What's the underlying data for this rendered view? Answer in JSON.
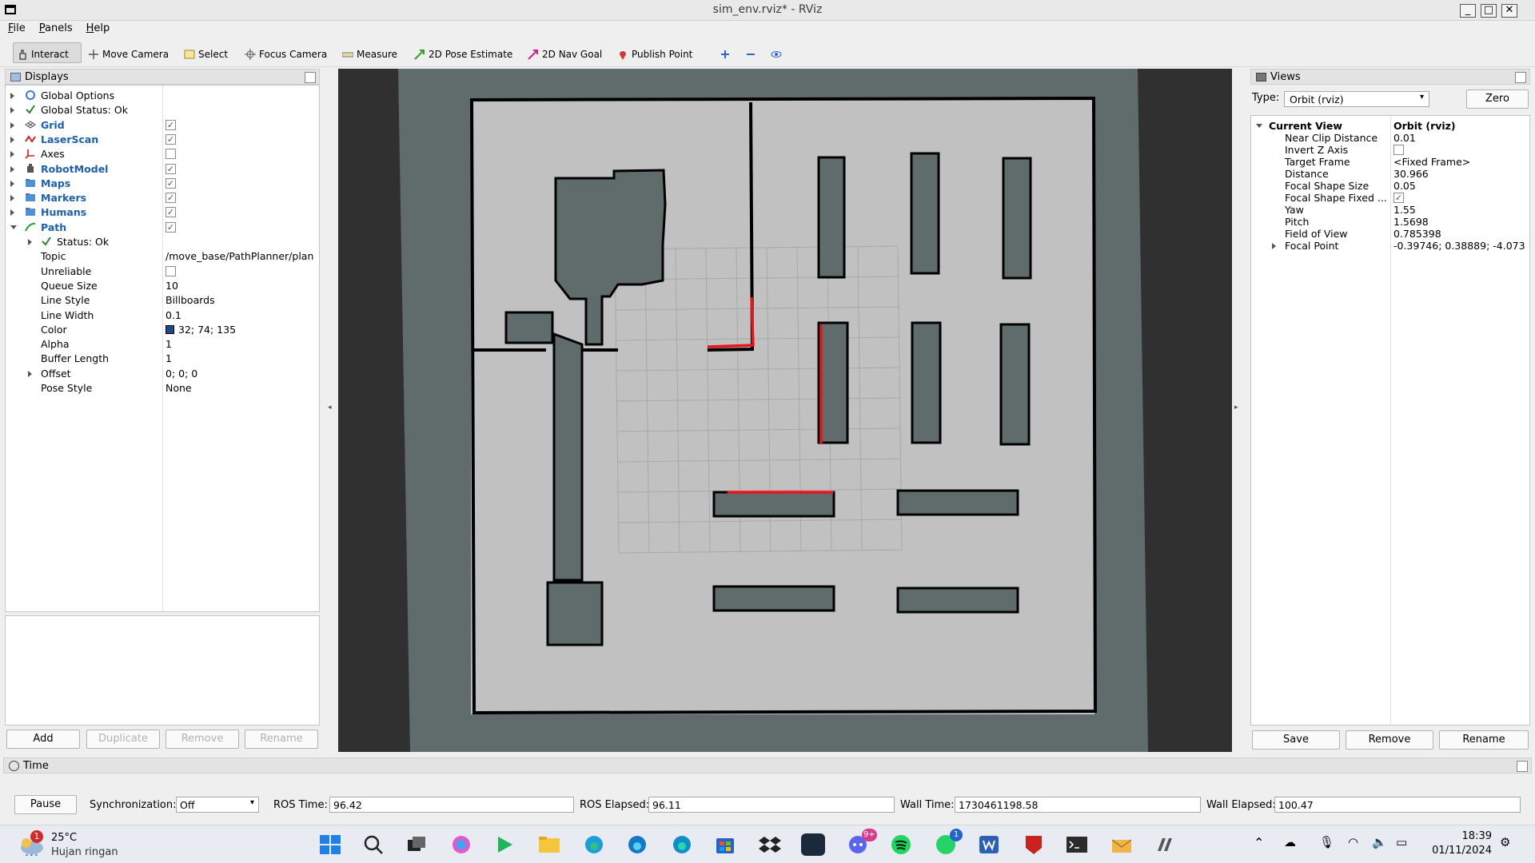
{
  "window": {
    "title": "sim_env.rviz* - RViz"
  },
  "menu": [
    "File",
    "Panels",
    "Help"
  ],
  "toolbar": {
    "tools": [
      "Interact",
      "Move Camera",
      "Select",
      "Focus Camera",
      "Measure",
      "2D Pose Estimate",
      "2D Nav Goal",
      "Publish Point"
    ],
    "active": "Interact"
  },
  "displays": {
    "title": "Displays",
    "items": [
      {
        "label": "Global Options",
        "icon": "gear-icon",
        "checked": null,
        "bold": false
      },
      {
        "label": "Global Status: Ok",
        "icon": "check-icon",
        "checked": null,
        "bold": false
      },
      {
        "label": "Grid",
        "icon": "grid-icon",
        "checked": true,
        "bold": true
      },
      {
        "label": "LaserScan",
        "icon": "laser-icon",
        "checked": true,
        "bold": true
      },
      {
        "label": "Axes",
        "icon": "axes-icon",
        "checked": false,
        "bold": false
      },
      {
        "label": "RobotModel",
        "icon": "robot-icon",
        "checked": true,
        "bold": true
      },
      {
        "label": "Maps",
        "icon": "folder-icon",
        "checked": true,
        "bold": true
      },
      {
        "label": "Markers",
        "icon": "folder-icon",
        "checked": true,
        "bold": true
      },
      {
        "label": "Humans",
        "icon": "folder-icon",
        "checked": true,
        "bold": true
      },
      {
        "label": "Path",
        "icon": "path-icon",
        "checked": true,
        "bold": true
      }
    ],
    "path_props": [
      {
        "name": "Status: Ok",
        "value": ""
      },
      {
        "name": "Topic",
        "value": "/move_base/PathPlanner/plan"
      },
      {
        "name": "Unreliable",
        "value": ""
      },
      {
        "name": "Queue Size",
        "value": "10"
      },
      {
        "name": "Line Style",
        "value": "Billboards"
      },
      {
        "name": "Line Width",
        "value": "0.1"
      },
      {
        "name": "Color",
        "value": "32; 74; 135"
      },
      {
        "name": "Alpha",
        "value": "1"
      },
      {
        "name": "Buffer Length",
        "value": "1"
      },
      {
        "name": "Offset",
        "value": "0; 0; 0"
      },
      {
        "name": "Pose Style",
        "value": "None"
      }
    ],
    "buttons": [
      "Add",
      "Duplicate",
      "Remove",
      "Rename"
    ]
  },
  "views": {
    "title": "Views",
    "type_label": "Type:",
    "type_value": "Orbit (rviz)",
    "zero": "Zero",
    "current_view": "Current View",
    "current_view_value": "Orbit (rviz)",
    "props": [
      {
        "name": "Near Clip Distance",
        "value": "0.01"
      },
      {
        "name": "Invert Z Axis",
        "value": ""
      },
      {
        "name": "Target Frame",
        "value": "<Fixed Frame>"
      },
      {
        "name": "Distance",
        "value": "30.966"
      },
      {
        "name": "Focal Shape Size",
        "value": "0.05"
      },
      {
        "name": "Focal Shape Fixed ...",
        "value": ""
      },
      {
        "name": "Yaw",
        "value": "1.55"
      },
      {
        "name": "Pitch",
        "value": "1.5698"
      },
      {
        "name": "Field of View",
        "value": "0.785398"
      },
      {
        "name": "Focal Point",
        "value": "-0.39746; 0.38889; -4.073"
      }
    ],
    "buttons": [
      "Save",
      "Remove",
      "Rename"
    ]
  },
  "time": {
    "title": "Time",
    "pause": "Pause",
    "sync_label": "Synchronization:",
    "sync_value": "Off",
    "ros_time_label": "ROS Time:",
    "ros_time": "96.42",
    "ros_elapsed_label": "ROS Elapsed:",
    "ros_elapsed": "96.11",
    "wall_time_label": "Wall Time:",
    "wall_time": "1730461198.58",
    "wall_elapsed_label": "Wall Elapsed:",
    "wall_elapsed": "100.47"
  },
  "taskbar": {
    "weather_temp": "25°C",
    "weather_desc": "Hujan ringan",
    "weather_badge": "1",
    "discord_badge": "9+",
    "whatsapp_badge": "1",
    "clock_time": "18:39",
    "clock_date": "01/11/2024"
  },
  "colors": {
    "path_color": "#204a87",
    "map_free": "#c1c1c1",
    "map_unknown": "#5f6c6b",
    "wall": "#000000",
    "laser": "#e8151b"
  }
}
